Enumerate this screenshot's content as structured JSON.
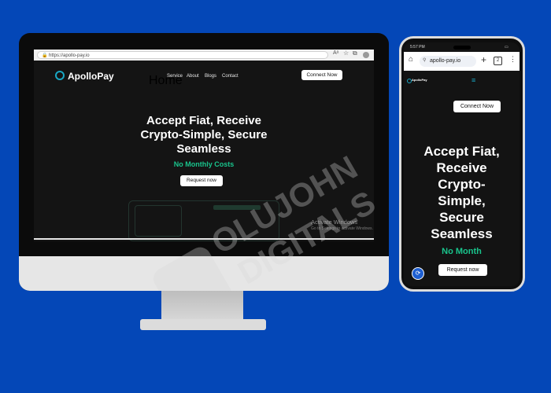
{
  "desktop": {
    "browser": {
      "url": "https://apollo-pay.io"
    },
    "logo": {
      "text": "ApolloPay"
    },
    "nav": [
      {
        "label": "Home"
      },
      {
        "label": "Service"
      },
      {
        "label": "About"
      },
      {
        "label": "Blogs"
      },
      {
        "label": "Contact"
      }
    ],
    "connect_button": "Connect Now",
    "hero": {
      "line1": "Accept Fiat, Receive",
      "line2": "Crypto-Simple, Secure",
      "line3": "Seamless",
      "subtitle": "No Monthly Costs",
      "cta": "Request now"
    },
    "overlay": {
      "line1": "Activate Windows",
      "line2": "Go to Settings to activate Windows."
    }
  },
  "phone": {
    "status_time": "5:57 PM",
    "url": "apollo-pay.io",
    "tabs_count": "2",
    "logo_text": "ApolloPay",
    "connect_button": "Connect Now",
    "hero": {
      "line1": "Accept Fiat,",
      "line2": "Receive",
      "line3": "Crypto-",
      "line4": "Simple,",
      "line5": "Secure",
      "line6": "Seamless",
      "subtitle": "No Month",
      "cta": "Request now"
    }
  },
  "watermark": {
    "line1": "OLUJOHN",
    "line2": "DIGITALS"
  },
  "colors": {
    "background": "#0447b7",
    "accent": "#19c48c"
  }
}
